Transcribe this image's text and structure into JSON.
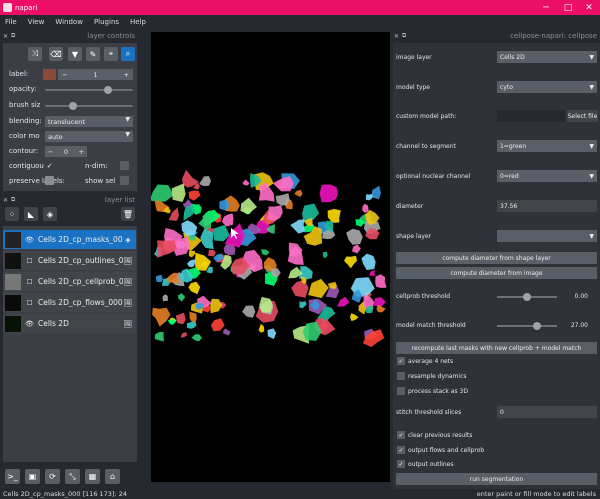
{
  "window": {
    "title": "napari",
    "minimize": "─",
    "maximize": "□",
    "close": "✕"
  },
  "menu": [
    "File",
    "View",
    "Window",
    "Plugins",
    "Help"
  ],
  "layer_controls": {
    "title": "layer controls",
    "label_label": "label:",
    "label_value": "1",
    "opacity_label": "opacity:",
    "opacity_value": 0.74,
    "brush_label": "brush siz",
    "brush_value": 0.3,
    "blending_label": "blending:",
    "blending_value": "translucent",
    "colormode_label": "color mo",
    "colormode_value": "auto",
    "contour_label": "contour:",
    "contour_value": "0",
    "contiguous_label": "contiguou",
    "ndim_label": "n-dim:",
    "preserve_label": "preserve labels:",
    "showsel_label": "show sel",
    "minus": "−",
    "plus": "+",
    "check": "✓"
  },
  "layer_list": {
    "title": "layer list",
    "layers": [
      {
        "name": "Cells 2D_cp_masks_000",
        "selected": true,
        "eye": "👁",
        "icon": "◈"
      },
      {
        "name": "Cells 2D_cp_outlines_000",
        "selected": false,
        "eye": "☐",
        "icon": "🖼"
      },
      {
        "name": "Cells 2D_cp_cellprob_000",
        "selected": false,
        "eye": "☐",
        "icon": "🖼"
      },
      {
        "name": "Cells 2D_cp_flows_000",
        "selected": false,
        "eye": "☐",
        "icon": "🖼"
      },
      {
        "name": "Cells 2D",
        "selected": false,
        "eye": "👁",
        "icon": "🖼"
      }
    ]
  },
  "plugin": {
    "title": "cellpose-napari: cellpose",
    "image_layer_label": "image layer",
    "image_layer_value": "Cells 2D",
    "model_type_label": "model type",
    "model_type_value": "cyto",
    "custom_model_label": "custom model path:",
    "select_file": "Select file",
    "channel_label": "channel to segment",
    "channel_value": "1=green",
    "nuclear_label": "optional nuclear channel",
    "nuclear_value": "0=red",
    "diameter_label": "diameter",
    "diameter_value": "37.56",
    "shape_layer_label": "shape layer",
    "shape_layer_value": "",
    "btn_diam_shape": "compute diameter from shape layer",
    "btn_diam_image": "compute diameter from image",
    "cellprob_label": "cellprob threshold",
    "cellprob_value": "0.00",
    "cellprob_frac": 0.5,
    "match_label": "model match threshold",
    "match_value": "27.00",
    "match_frac": 0.7,
    "btn_recompute": "recompute last masks with new cellprob + model match",
    "avg_label": "average 4 nets",
    "avg_checked": true,
    "resample_label": "resample dynamics",
    "resample_checked": false,
    "stack_label": "process stack as 3D",
    "stack_checked": false,
    "stitch_label": "stitch threshold slices",
    "stitch_value": "0",
    "clear_label": "clear previous results",
    "clear_checked": true,
    "flows_label": "output flows and cellprob",
    "flows_checked": true,
    "outlines_label": "output outlines",
    "outlines_checked": true,
    "btn_run": "run segmentation"
  },
  "status": {
    "left": "Cells 2D_cp_masks_000 [116 173]: 24",
    "right": "enter paint or fill mode to edit labels"
  },
  "colors": {
    "accent": "#ec0f66",
    "selected": "#1a72c4",
    "panel": "#3b3e45",
    "bg": "#262930"
  }
}
